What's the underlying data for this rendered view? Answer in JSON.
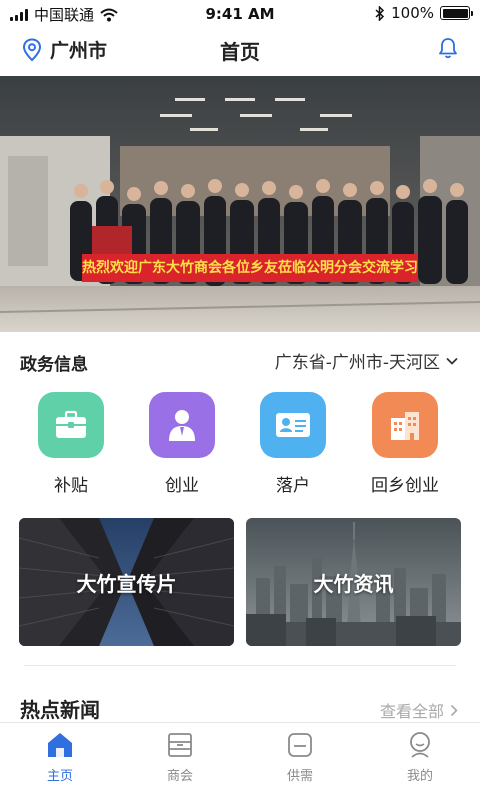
{
  "status_bar": {
    "carrier": "中国联通",
    "time": "9:41 AM",
    "battery": "100%"
  },
  "header": {
    "location": "广州市",
    "title": "首页"
  },
  "banner": {
    "caption": "热烈欢迎广东大竹商会各位乡友莅临公明分会交流学习"
  },
  "gov_info": {
    "title": "政务信息",
    "region": "广东省-广州市-天河区",
    "services": [
      {
        "label": "补贴",
        "icon": "briefcase-icon",
        "color": "#5fd0a8"
      },
      {
        "label": "创业",
        "icon": "businessman-icon",
        "color": "#9a70e6"
      },
      {
        "label": "落户",
        "icon": "id-card-icon",
        "color": "#4fb1ef"
      },
      {
        "label": "回乡创业",
        "icon": "building-icon",
        "color": "#f28a55"
      }
    ]
  },
  "cards": [
    {
      "title": "大竹宣传片"
    },
    {
      "title": "大竹资讯"
    }
  ],
  "news": {
    "title": "热点新闻",
    "see_all": "查看全部"
  },
  "tabs": [
    {
      "label": "主页",
      "icon": "home-icon",
      "active": true
    },
    {
      "label": "商会",
      "icon": "chamber-icon",
      "active": false
    },
    {
      "label": "供需",
      "icon": "supply-demand-icon",
      "active": false
    },
    {
      "label": "我的",
      "icon": "profile-icon",
      "active": false
    }
  ],
  "colors": {
    "accent": "#2f6fe0",
    "tab_inactive": "#8a8a8a",
    "banner_red": "#d8242a"
  }
}
